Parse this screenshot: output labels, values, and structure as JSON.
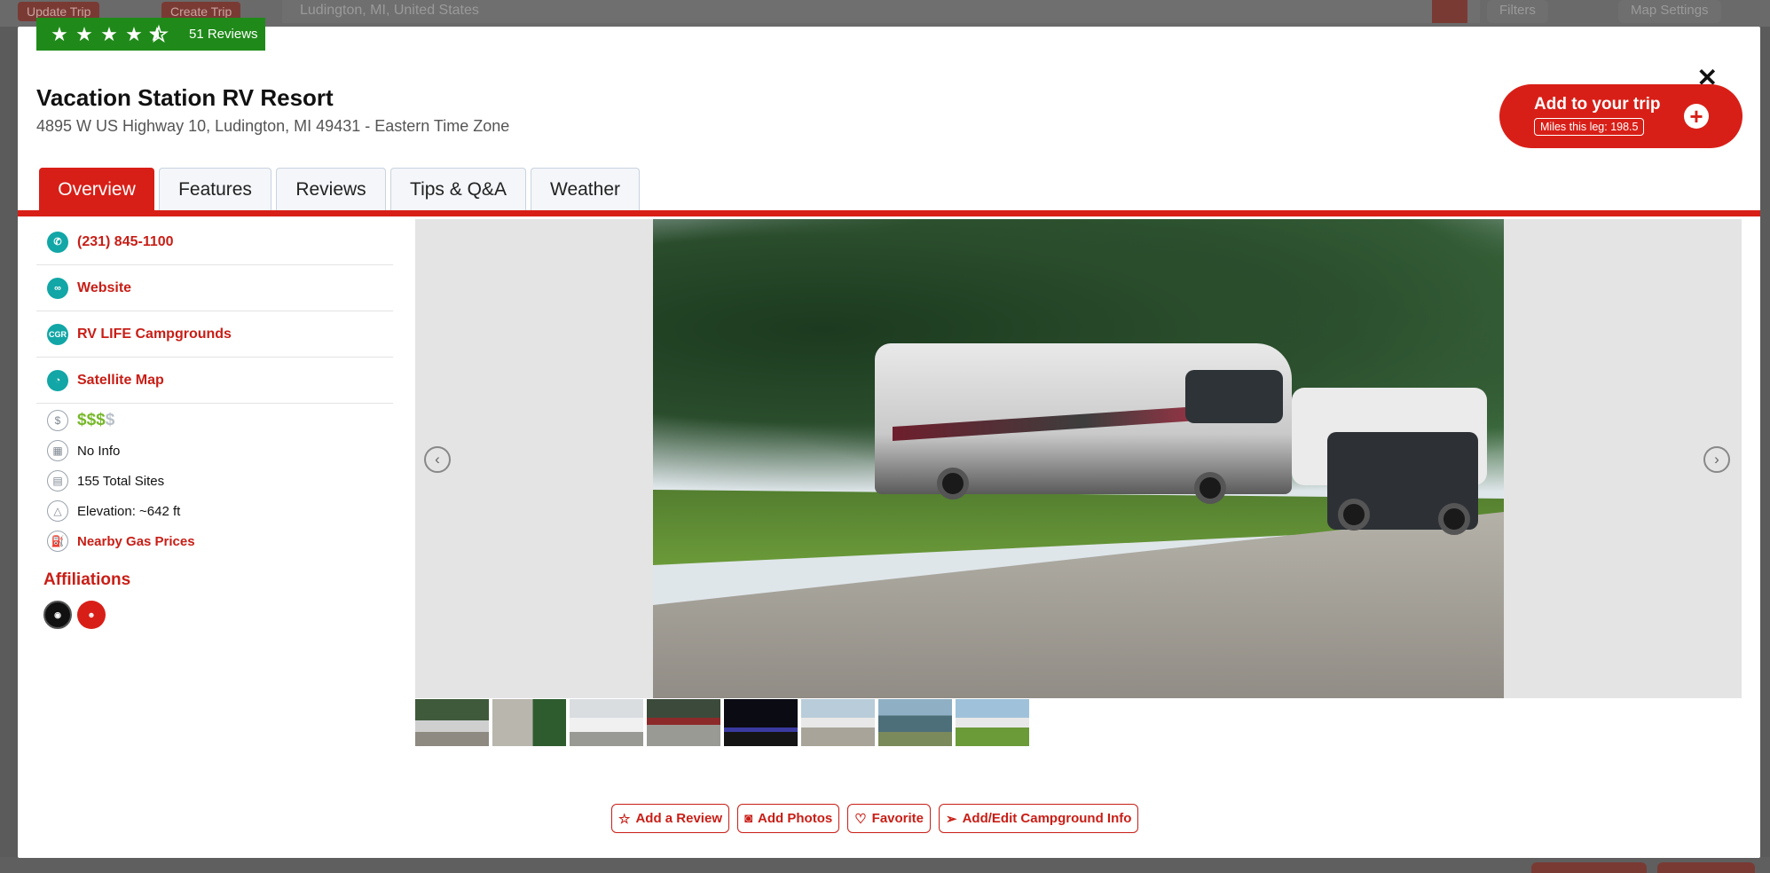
{
  "background": {
    "buttons": [
      "Update Trip",
      "Create Trip"
    ],
    "search_value": "Ludington, MI, United States",
    "filters_label": "Filters",
    "map_settings_label": "Map Settings"
  },
  "rating": {
    "stars": 4.5,
    "max": 5,
    "count_label": "51 Reviews"
  },
  "campground": {
    "name": "Vacation Station RV Resort",
    "address": "4895 W US Highway 10, Ludington, MI 49431 - Eastern Time Zone"
  },
  "trip": {
    "add_label": "Add to your trip",
    "miles_label": "Miles this leg: 198.5"
  },
  "tabs": [
    {
      "label": "Overview",
      "active": true
    },
    {
      "label": "Features",
      "active": false
    },
    {
      "label": "Reviews",
      "active": false
    },
    {
      "label": "Tips & Q&A",
      "active": false
    },
    {
      "label": "Weather",
      "active": false
    }
  ],
  "contact": {
    "phone": "(231) 845-1100",
    "website": "Website",
    "rvlife": "RV LIFE Campgrounds",
    "satellite": "Satellite Map"
  },
  "details": {
    "price_active": "$$$",
    "price_inactive": "$",
    "season": "No Info",
    "sites": "155 Total Sites",
    "elevation": "Elevation: ~642 ft",
    "gas": "Nearby Gas Prices"
  },
  "affiliations": {
    "title": "Affiliations"
  },
  "gallery": {
    "thumb_count": 8
  },
  "actions": {
    "review": "Add a Review",
    "photos": "Add Photos",
    "favorite": "Favorite",
    "edit": "Add/Edit Campground Info"
  },
  "colors": {
    "brand_red": "#d81f17",
    "rating_green": "#1f8a19",
    "teal": "#12a6a6",
    "price_green": "#76b82a"
  }
}
